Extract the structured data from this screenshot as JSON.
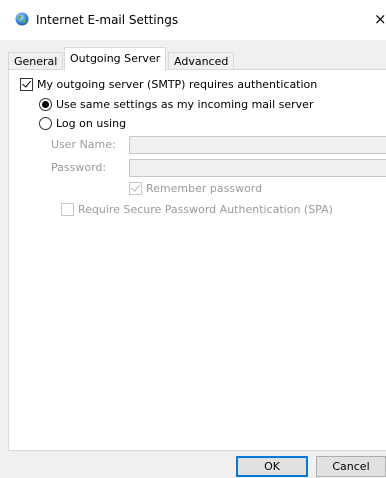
{
  "window": {
    "title": "Internet E-mail Settings",
    "close_glyph": "×",
    "icon": "globe-icon"
  },
  "tabs": [
    {
      "label": "General",
      "selected": false
    },
    {
      "label": "Outgoing Server",
      "selected": true
    },
    {
      "label": "Advanced",
      "selected": false
    }
  ],
  "outgoing": {
    "requires_auth_label": "My outgoing server (SMTP) requires authentication",
    "requires_auth_checked": true,
    "use_same_label": "Use same settings as my incoming mail server",
    "use_same_selected": true,
    "log_on_label": "Log on using",
    "log_on_selected": false,
    "user_name_label": "User Name:",
    "user_name_value": "",
    "password_label": "Password:",
    "password_value": "",
    "remember_label": "Remember password",
    "remember_checked": true,
    "spa_label": "Require Secure Password Authentication (SPA)",
    "spa_checked": false
  },
  "buttons": {
    "ok_label": "OK",
    "cancel_label": "Cancel"
  },
  "colors": {
    "accent": "#0078d7",
    "disabled_text": "#9a9a9a"
  }
}
